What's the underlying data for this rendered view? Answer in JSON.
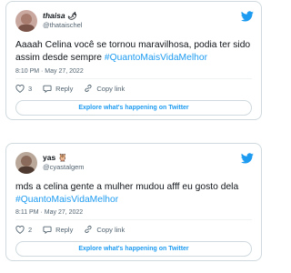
{
  "tweets": [
    {
      "display_name": "thaisa",
      "name_emoji": "🌶",
      "handle": "@thataischel",
      "text_main": "Aaaah Celina você se tornou maravilhosa, podia ter sido assim desde sempre ",
      "hashtag": "#QuantoMaisVidaMelhor",
      "time": "8:10 PM · May 27, 2022",
      "likes": "3",
      "reply_label": "Reply",
      "copy_label": "Copy link",
      "explore_label": "Explore what's happening on Twitter"
    },
    {
      "display_name": "yas",
      "name_emoji": "🦉",
      "handle": "@cyastalgem",
      "text_main": "mds a celina gente a mulher mudou afff eu gosto dela ",
      "hashtag": "#QuantoMaisVidaMelhor",
      "time": "8:11 PM · May 27, 2022",
      "likes": "2",
      "reply_label": "Reply",
      "copy_label": "Copy link",
      "explore_label": "Explore what's happening on Twitter"
    }
  ],
  "colors": {
    "twitter_blue": "#1d9bf0",
    "muted": "#536471",
    "border": "#cfd9de"
  },
  "icons": [
    "twitter-bird-icon",
    "heart-icon",
    "reply-icon",
    "link-icon"
  ]
}
